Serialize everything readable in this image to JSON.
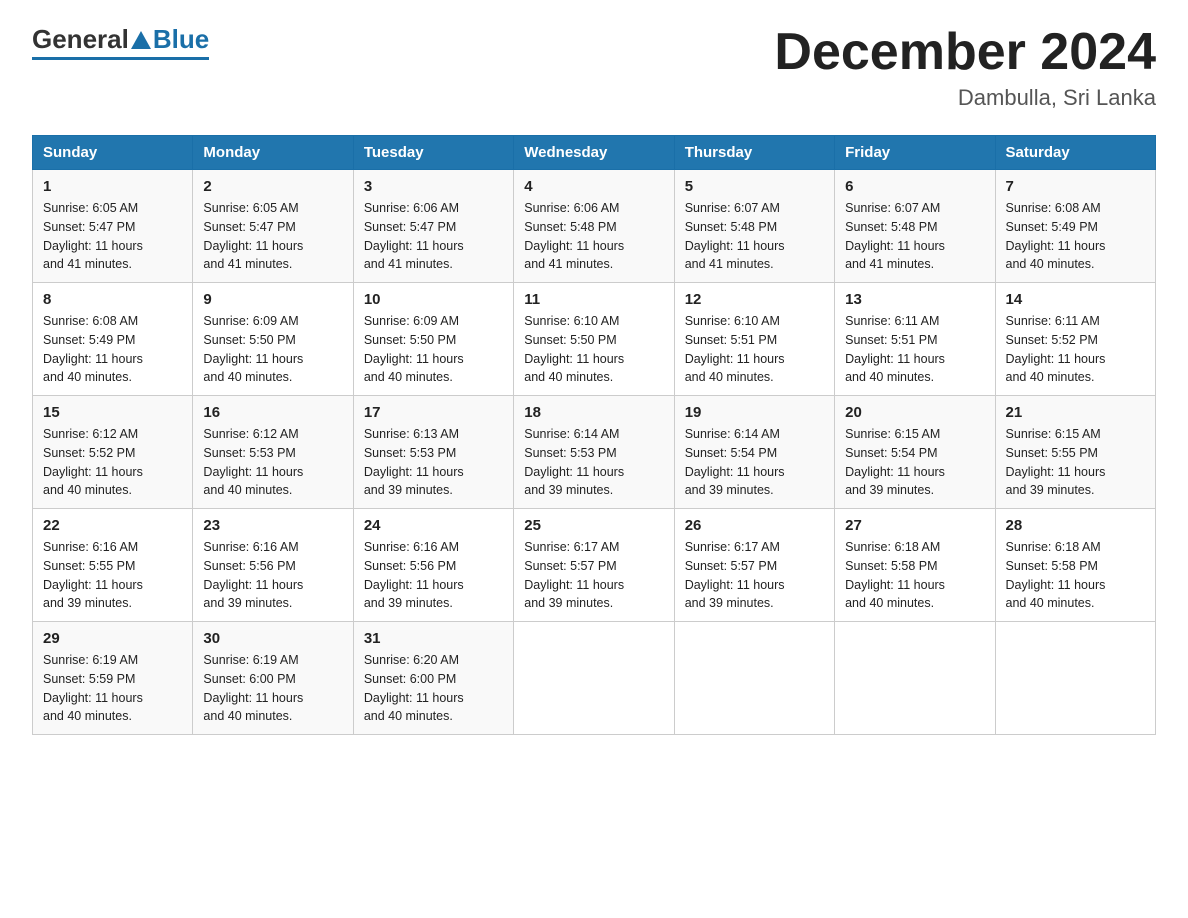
{
  "logo": {
    "general": "General",
    "blue": "Blue"
  },
  "title": "December 2024",
  "location": "Dambulla, Sri Lanka",
  "headers": [
    "Sunday",
    "Monday",
    "Tuesday",
    "Wednesday",
    "Thursday",
    "Friday",
    "Saturday"
  ],
  "weeks": [
    [
      {
        "day": "1",
        "sunrise": "6:05 AM",
        "sunset": "5:47 PM",
        "daylight": "11 hours and 41 minutes."
      },
      {
        "day": "2",
        "sunrise": "6:05 AM",
        "sunset": "5:47 PM",
        "daylight": "11 hours and 41 minutes."
      },
      {
        "day": "3",
        "sunrise": "6:06 AM",
        "sunset": "5:47 PM",
        "daylight": "11 hours and 41 minutes."
      },
      {
        "day": "4",
        "sunrise": "6:06 AM",
        "sunset": "5:48 PM",
        "daylight": "11 hours and 41 minutes."
      },
      {
        "day": "5",
        "sunrise": "6:07 AM",
        "sunset": "5:48 PM",
        "daylight": "11 hours and 41 minutes."
      },
      {
        "day": "6",
        "sunrise": "6:07 AM",
        "sunset": "5:48 PM",
        "daylight": "11 hours and 41 minutes."
      },
      {
        "day": "7",
        "sunrise": "6:08 AM",
        "sunset": "5:49 PM",
        "daylight": "11 hours and 40 minutes."
      }
    ],
    [
      {
        "day": "8",
        "sunrise": "6:08 AM",
        "sunset": "5:49 PM",
        "daylight": "11 hours and 40 minutes."
      },
      {
        "day": "9",
        "sunrise": "6:09 AM",
        "sunset": "5:50 PM",
        "daylight": "11 hours and 40 minutes."
      },
      {
        "day": "10",
        "sunrise": "6:09 AM",
        "sunset": "5:50 PM",
        "daylight": "11 hours and 40 minutes."
      },
      {
        "day": "11",
        "sunrise": "6:10 AM",
        "sunset": "5:50 PM",
        "daylight": "11 hours and 40 minutes."
      },
      {
        "day": "12",
        "sunrise": "6:10 AM",
        "sunset": "5:51 PM",
        "daylight": "11 hours and 40 minutes."
      },
      {
        "day": "13",
        "sunrise": "6:11 AM",
        "sunset": "5:51 PM",
        "daylight": "11 hours and 40 minutes."
      },
      {
        "day": "14",
        "sunrise": "6:11 AM",
        "sunset": "5:52 PM",
        "daylight": "11 hours and 40 minutes."
      }
    ],
    [
      {
        "day": "15",
        "sunrise": "6:12 AM",
        "sunset": "5:52 PM",
        "daylight": "11 hours and 40 minutes."
      },
      {
        "day": "16",
        "sunrise": "6:12 AM",
        "sunset": "5:53 PM",
        "daylight": "11 hours and 40 minutes."
      },
      {
        "day": "17",
        "sunrise": "6:13 AM",
        "sunset": "5:53 PM",
        "daylight": "11 hours and 39 minutes."
      },
      {
        "day": "18",
        "sunrise": "6:14 AM",
        "sunset": "5:53 PM",
        "daylight": "11 hours and 39 minutes."
      },
      {
        "day": "19",
        "sunrise": "6:14 AM",
        "sunset": "5:54 PM",
        "daylight": "11 hours and 39 minutes."
      },
      {
        "day": "20",
        "sunrise": "6:15 AM",
        "sunset": "5:54 PM",
        "daylight": "11 hours and 39 minutes."
      },
      {
        "day": "21",
        "sunrise": "6:15 AM",
        "sunset": "5:55 PM",
        "daylight": "11 hours and 39 minutes."
      }
    ],
    [
      {
        "day": "22",
        "sunrise": "6:16 AM",
        "sunset": "5:55 PM",
        "daylight": "11 hours and 39 minutes."
      },
      {
        "day": "23",
        "sunrise": "6:16 AM",
        "sunset": "5:56 PM",
        "daylight": "11 hours and 39 minutes."
      },
      {
        "day": "24",
        "sunrise": "6:16 AM",
        "sunset": "5:56 PM",
        "daylight": "11 hours and 39 minutes."
      },
      {
        "day": "25",
        "sunrise": "6:17 AM",
        "sunset": "5:57 PM",
        "daylight": "11 hours and 39 minutes."
      },
      {
        "day": "26",
        "sunrise": "6:17 AM",
        "sunset": "5:57 PM",
        "daylight": "11 hours and 39 minutes."
      },
      {
        "day": "27",
        "sunrise": "6:18 AM",
        "sunset": "5:58 PM",
        "daylight": "11 hours and 40 minutes."
      },
      {
        "day": "28",
        "sunrise": "6:18 AM",
        "sunset": "5:58 PM",
        "daylight": "11 hours and 40 minutes."
      }
    ],
    [
      {
        "day": "29",
        "sunrise": "6:19 AM",
        "sunset": "5:59 PM",
        "daylight": "11 hours and 40 minutes."
      },
      {
        "day": "30",
        "sunrise": "6:19 AM",
        "sunset": "6:00 PM",
        "daylight": "11 hours and 40 minutes."
      },
      {
        "day": "31",
        "sunrise": "6:20 AM",
        "sunset": "6:00 PM",
        "daylight": "11 hours and 40 minutes."
      },
      null,
      null,
      null,
      null
    ]
  ],
  "labels": {
    "sunrise": "Sunrise:",
    "sunset": "Sunset:",
    "daylight": "Daylight:"
  }
}
